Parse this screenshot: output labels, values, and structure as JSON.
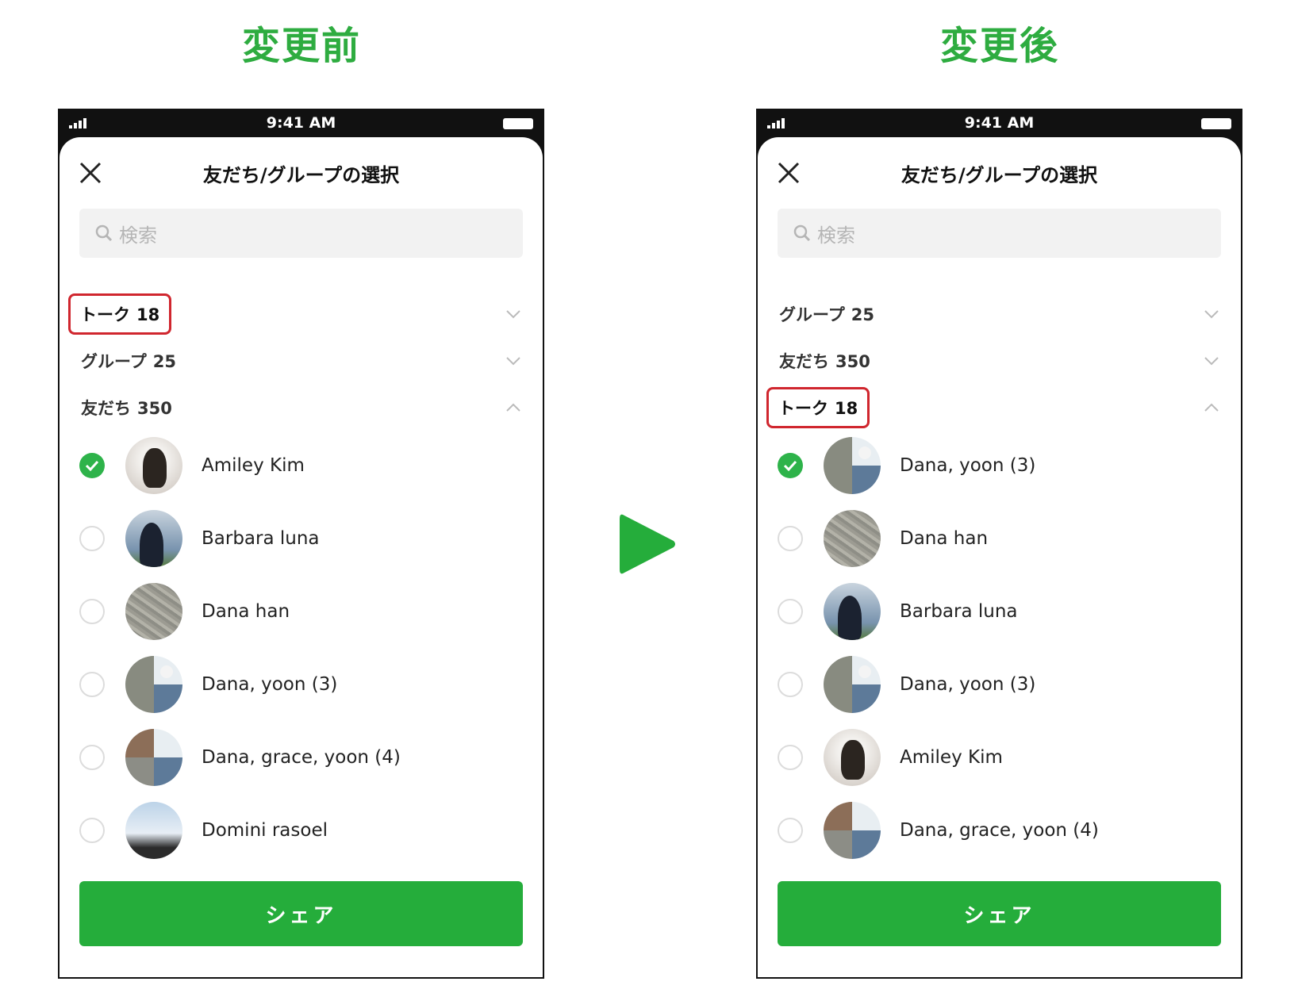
{
  "headings": {
    "before": "変更前",
    "after": "変更後"
  },
  "colors": {
    "accent": "#2eac40",
    "highlight": "#d0262e",
    "button": "#25ad3b"
  },
  "before": {
    "status_time": "9:41 AM",
    "title": "友だち/グループの選択",
    "search_placeholder": "検索",
    "sections": [
      {
        "label": "トーク",
        "count": "18",
        "highlighted": true,
        "chevron": "chevron-down"
      },
      {
        "label": "グループ",
        "count": "25",
        "highlighted": false,
        "chevron": "chevron-down"
      },
      {
        "label": "友だち",
        "count": "350",
        "highlighted": false,
        "chevron": "chevron-up"
      }
    ],
    "rows": [
      {
        "name": "Amiley Kim",
        "checked": true
      },
      {
        "name": "Barbara luna",
        "checked": false
      },
      {
        "name": "Dana han",
        "checked": false
      },
      {
        "name": "Dana, yoon (3)",
        "checked": false
      },
      {
        "name": "Dana, grace, yoon (4)",
        "checked": false
      },
      {
        "name": "Domini rasoel",
        "checked": false
      }
    ],
    "share_label": "シェア"
  },
  "after": {
    "status_time": "9:41 AM",
    "title": "友だち/グループの選択",
    "search_placeholder": "検索",
    "sections": [
      {
        "label": "グループ",
        "count": "25",
        "highlighted": false,
        "chevron": "chevron-down"
      },
      {
        "label": "友だち",
        "count": "350",
        "highlighted": false,
        "chevron": "chevron-down"
      },
      {
        "label": "トーク",
        "count": "18",
        "highlighted": true,
        "chevron": "chevron-up"
      }
    ],
    "rows": [
      {
        "name": "Dana, yoon (3)",
        "checked": true
      },
      {
        "name": "Dana han",
        "checked": false
      },
      {
        "name": "Barbara luna",
        "checked": false
      },
      {
        "name": "Dana, yoon (3)",
        "checked": false
      },
      {
        "name": "Amiley Kim",
        "checked": false
      },
      {
        "name": "Dana, grace, yoon (4)",
        "checked": false
      }
    ],
    "share_label": "シェア"
  }
}
